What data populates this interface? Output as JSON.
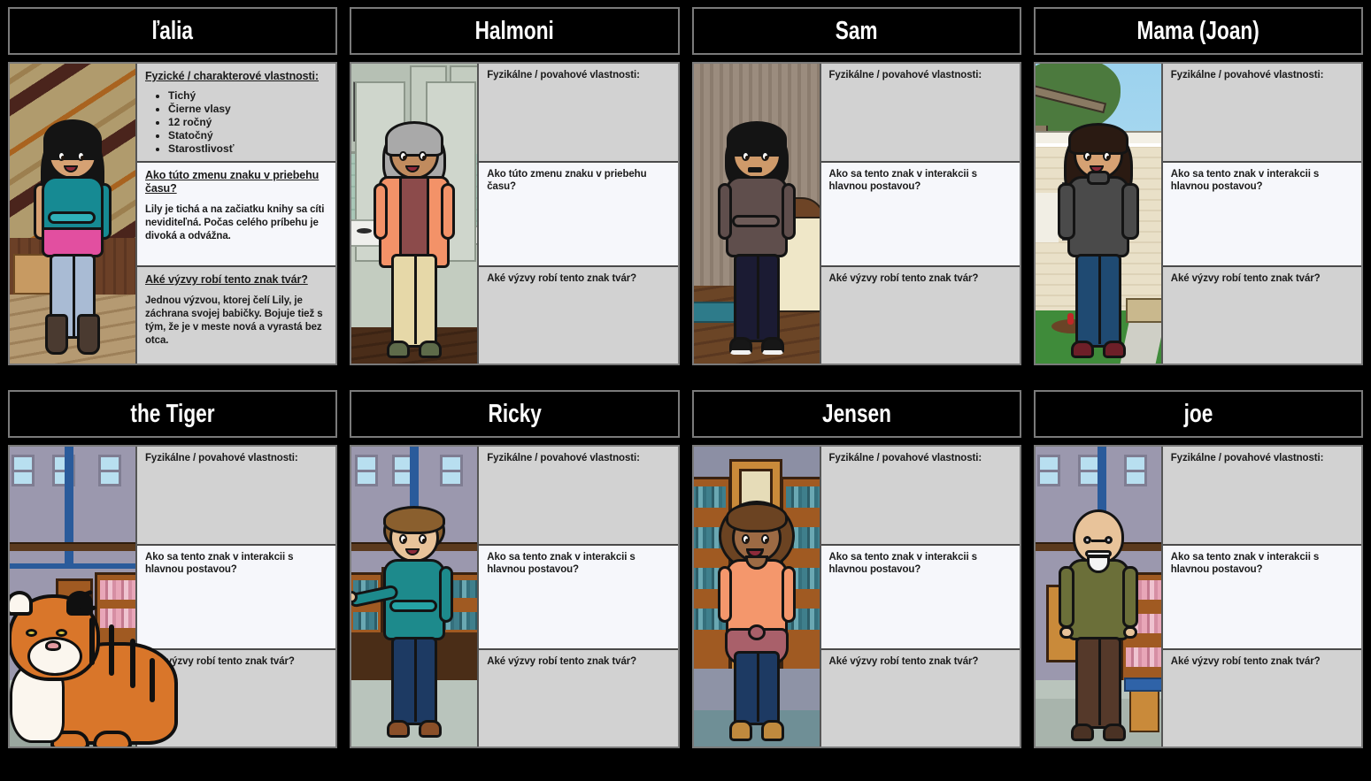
{
  "page": {
    "background": "#000000",
    "border_color": "#7a7a7a",
    "panel_gray": "#d2d2d2",
    "panel_white": "#f6f7fb"
  },
  "headers": {
    "traits_underlined": "Fyzické / charakterové vlastnosti:",
    "traits": "Fyzikálne / povahové vlastnosti:",
    "change_over_time": "Ako túto zmenu znaku v priebehu času?",
    "interaction": "Ako sa tento znak v interakcii s hlavnou postavou?",
    "challenges": "Aké výzvy robí tento znak tvár?"
  },
  "cells": [
    {
      "title": "ľalia",
      "scene": "attic",
      "character": "girl-lily",
      "panel1": {
        "header_key": "traits_underlined",
        "underline": true,
        "bullets": [
          "Tichý",
          "Čierne vlasy",
          "12 ročný",
          "Statočný",
          "Starostlivosť"
        ],
        "body": ""
      },
      "panel2": {
        "header_key": "change_over_time",
        "underline": true,
        "body": "Lily je tichá a na začiatku knihy sa cíti neviditeľná. Počas celého príbehu je divoká a odvážna."
      },
      "panel3": {
        "header_key": "challenges",
        "underline": true,
        "body": "Jednou výzvou, ktorej čelí Lily, je záchrana svojej babičky. Bojuje tiež s tým, že je v meste nová a vyrastá bez otca."
      }
    },
    {
      "title": "Halmoni",
      "scene": "kitchen",
      "character": "grandmother",
      "panel1": {
        "header_key": "traits",
        "underline": false,
        "bullets": [],
        "body": ""
      },
      "panel2": {
        "header_key": "change_over_time",
        "underline": false,
        "body": ""
      },
      "panel3": {
        "header_key": "challenges",
        "underline": false,
        "body": ""
      }
    },
    {
      "title": "Sam",
      "scene": "bedroom",
      "character": "teen-sam",
      "panel1": {
        "header_key": "traits",
        "underline": false,
        "bullets": [],
        "body": ""
      },
      "panel2": {
        "header_key": "interaction",
        "underline": false,
        "body": ""
      },
      "panel3": {
        "header_key": "challenges",
        "underline": false,
        "body": ""
      }
    },
    {
      "title": "Mama (Joan)",
      "scene": "yard",
      "character": "mother",
      "panel1": {
        "header_key": "traits",
        "underline": false,
        "bullets": [],
        "body": ""
      },
      "panel2": {
        "header_key": "interaction",
        "underline": false,
        "body": ""
      },
      "panel3": {
        "header_key": "challenges",
        "underline": false,
        "body": ""
      }
    },
    {
      "title": "the Tiger",
      "scene": "library",
      "character": "tiger",
      "panel1": {
        "header_key": "traits",
        "underline": false,
        "bullets": [],
        "body": ""
      },
      "panel2": {
        "header_key": "interaction",
        "underline": false,
        "body": ""
      },
      "panel3": {
        "header_key": "challenges",
        "underline": false,
        "body": ""
      }
    },
    {
      "title": "Ricky",
      "scene": "library",
      "character": "boy-ricky",
      "panel1": {
        "header_key": "traits",
        "underline": false,
        "bullets": [],
        "body": ""
      },
      "panel2": {
        "header_key": "interaction",
        "underline": false,
        "body": ""
      },
      "panel3": {
        "header_key": "challenges",
        "underline": false,
        "body": ""
      }
    },
    {
      "title": "Jensen",
      "scene": "library-shelves",
      "character": "woman-jensen",
      "panel1": {
        "header_key": "traits",
        "underline": false,
        "bullets": [],
        "body": ""
      },
      "panel2": {
        "header_key": "interaction",
        "underline": false,
        "body": ""
      },
      "panel3": {
        "header_key": "challenges",
        "underline": false,
        "body": ""
      }
    },
    {
      "title": "joe",
      "scene": "library",
      "character": "old-man-joe",
      "panel1": {
        "header_key": "traits",
        "underline": false,
        "bullets": [],
        "body": ""
      },
      "panel2": {
        "header_key": "interaction",
        "underline": false,
        "body": ""
      },
      "panel3": {
        "header_key": "challenges",
        "underline": false,
        "body": ""
      }
    }
  ]
}
